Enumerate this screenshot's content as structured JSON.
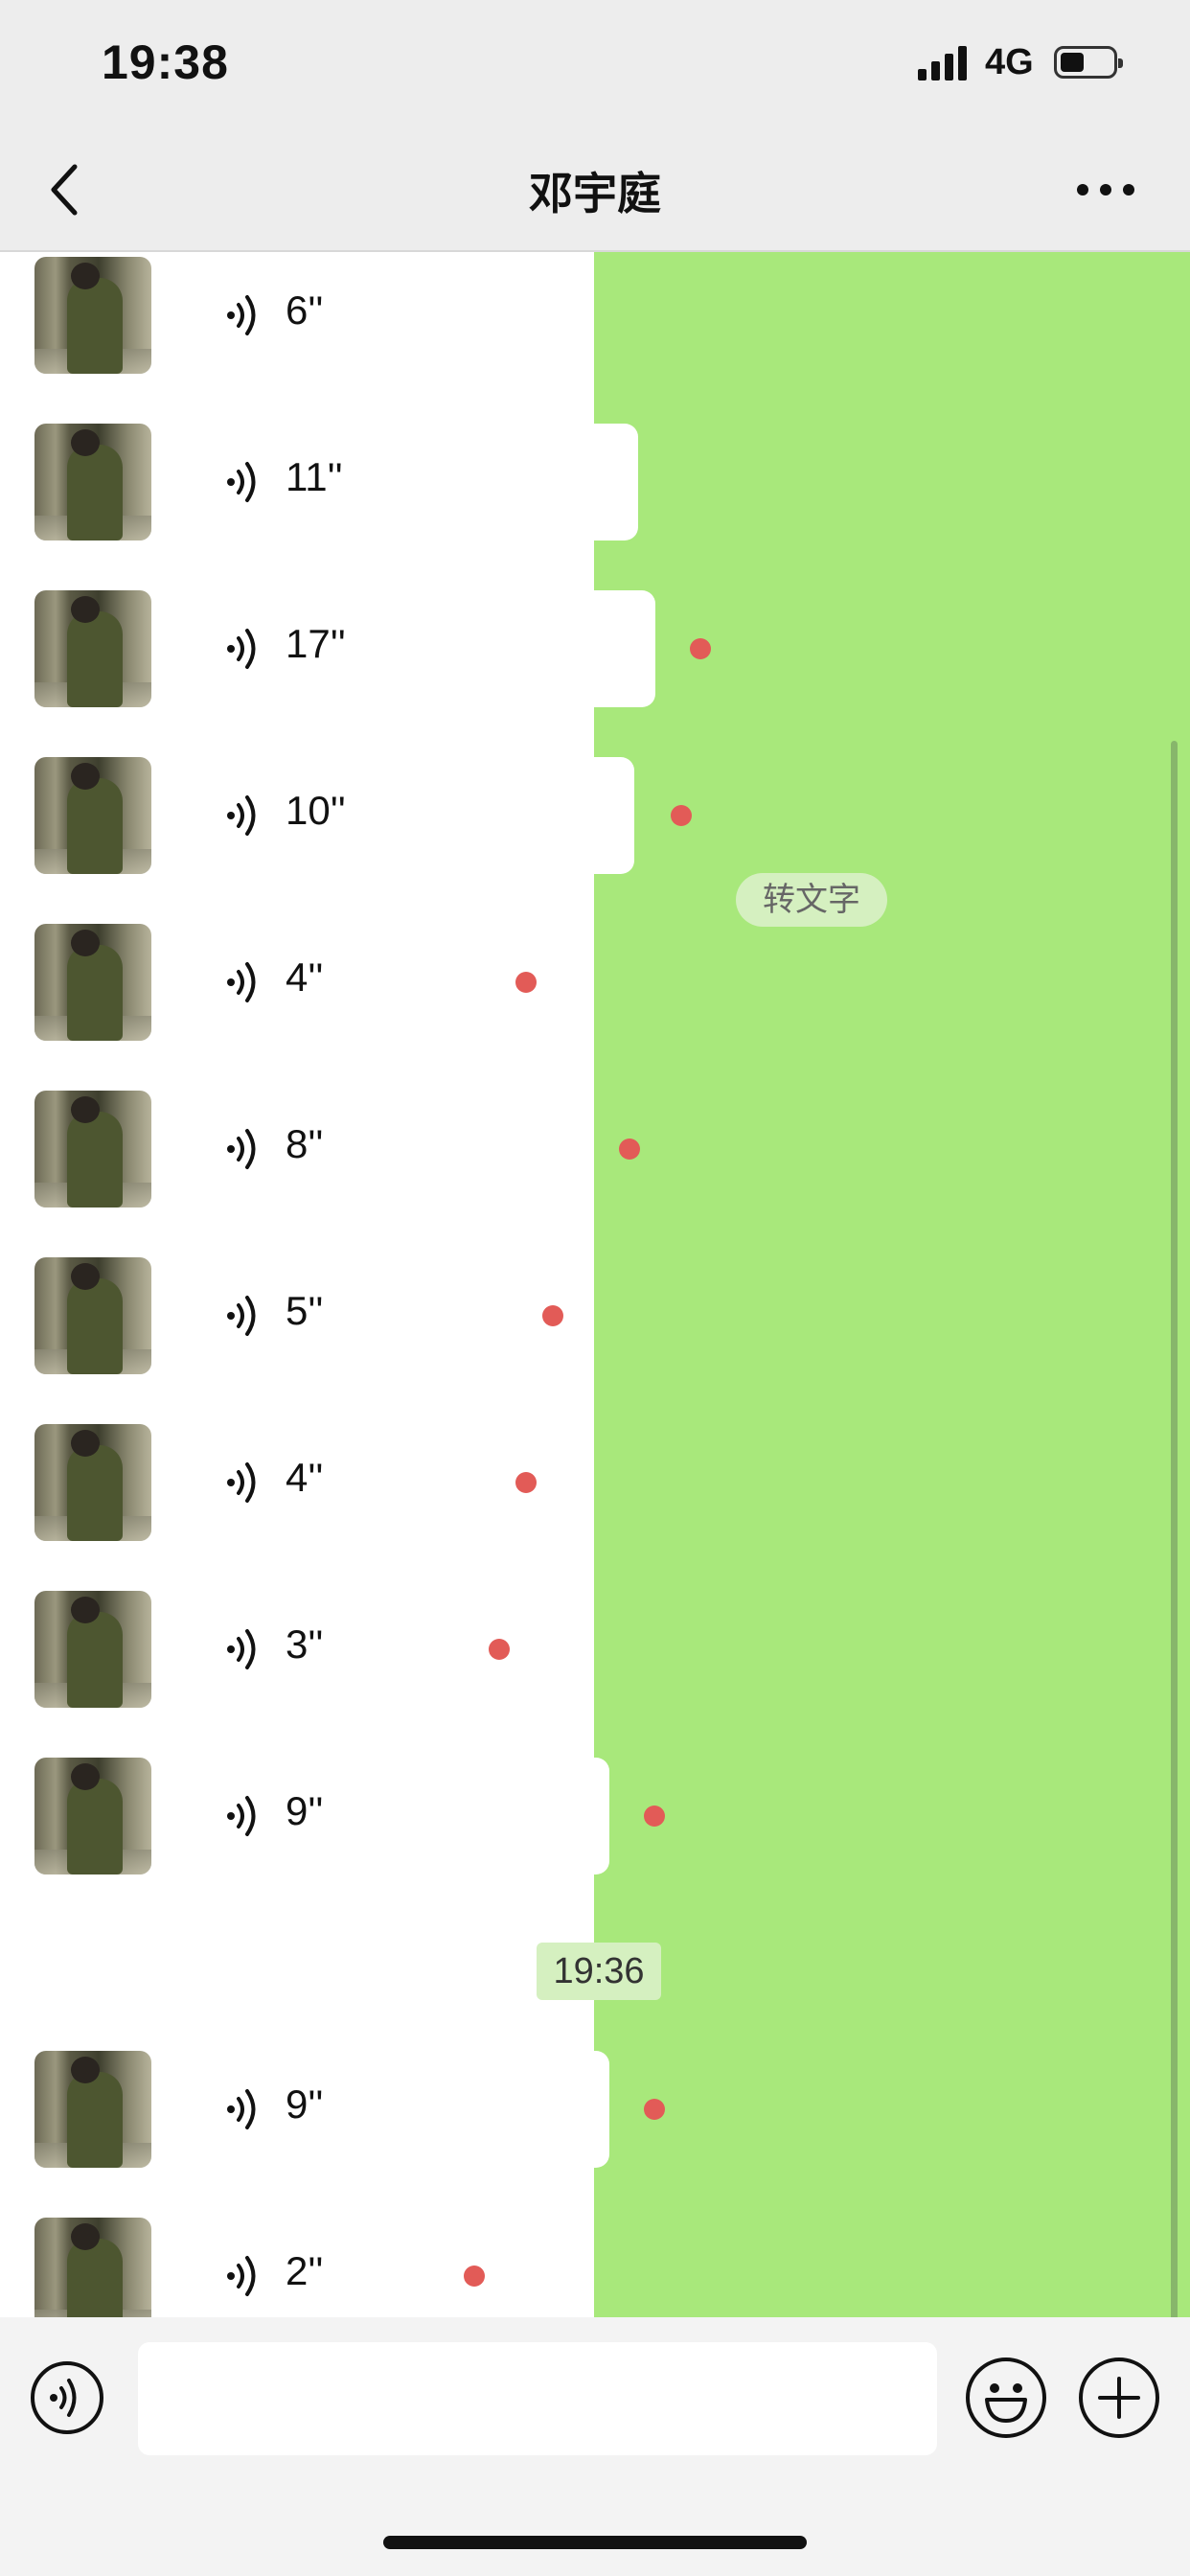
{
  "status_bar": {
    "time": "19:38",
    "network": "4G"
  },
  "header": {
    "title": "邓宇庭",
    "back_icon": "chevron-left-icon",
    "more_icon": "more-dots-icon"
  },
  "colors": {
    "chat_green": "#a8e87b",
    "unread_dot": "#e25b57",
    "bubble": "#ffffff"
  },
  "messages": [
    {
      "duration": "6''"
    },
    {
      "duration": "11''"
    },
    {
      "duration": "17''"
    },
    {
      "duration": "10''"
    },
    {
      "duration": "4''"
    },
    {
      "duration": "8''"
    },
    {
      "duration": "5''"
    },
    {
      "duration": "4''"
    },
    {
      "duration": "3''"
    },
    {
      "duration": "9''"
    },
    {
      "duration": "9''"
    },
    {
      "duration": "2''"
    }
  ],
  "convert_to_text_label": "转文字",
  "timestamp": "19:36",
  "input_bar": {
    "input_value": "",
    "voice_icon": "voice-input-icon",
    "emoji_icon": "emoji-icon",
    "plus_icon": "plus-icon"
  }
}
